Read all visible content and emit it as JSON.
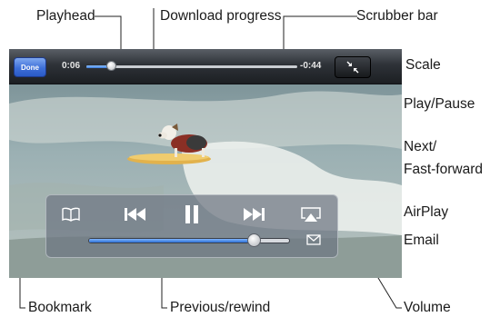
{
  "player": {
    "done_label": "Done",
    "elapsed": "0:06",
    "remaining": "-0:44",
    "playback_progress": 0.12,
    "download_progress": 1.0,
    "volume_level": 0.82
  },
  "callouts": {
    "playhead": "Playhead",
    "download_progress": "Download progress",
    "scrubber_bar": "Scrubber bar",
    "scale": "Scale",
    "play_pause": "Play/Pause",
    "next_line1": "Next/",
    "next_line2": "Fast-forward",
    "airplay": "AirPlay",
    "email": "Email",
    "bookmark": "Bookmark",
    "previous_rewind": "Previous/rewind",
    "volume": "Volume"
  },
  "icons": {
    "scale": "scale-icon",
    "bookmark": "book-icon",
    "previous": "previous-rewind-icon",
    "play_pause": "pause-icon",
    "next": "next-fast-forward-icon",
    "airplay": "airplay-icon",
    "email": "envelope-icon"
  },
  "colors": {
    "done_button": "#3d6fd8",
    "progress_fill": "#3b7bdb"
  }
}
